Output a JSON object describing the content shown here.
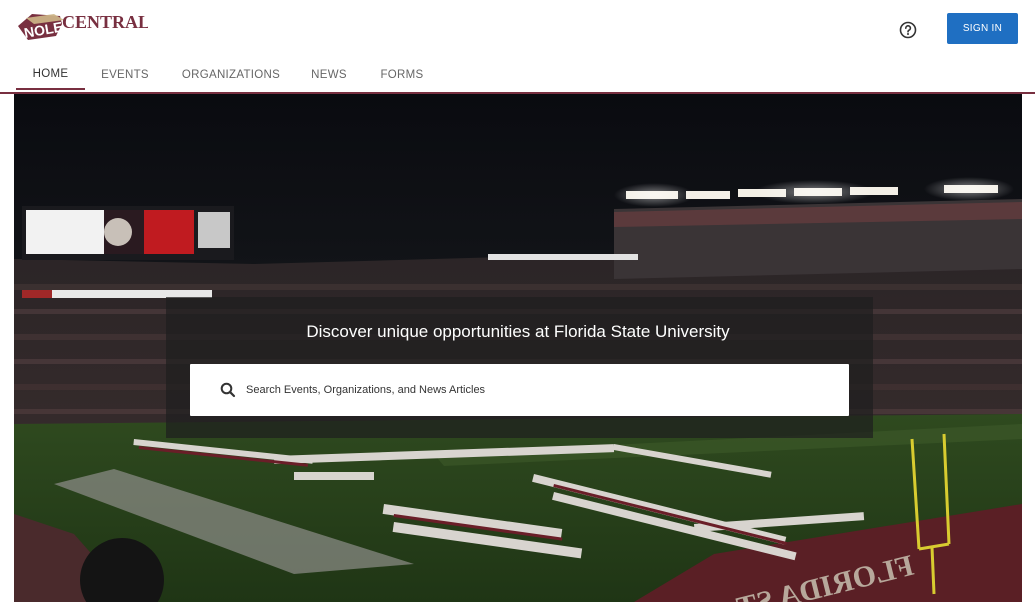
{
  "colors": {
    "brand_garnet": "#782f40",
    "brand_gold": "#ceb888",
    "signin_blue": "#1f6fc2",
    "nav_text": "#666666",
    "active_text": "#333333",
    "hero_text": "#ffffff",
    "panel_overlay": "rgba(30,30,30,0.72)"
  },
  "header": {
    "logo_text": "NOLECENTRAL",
    "help_icon": "question-circle-icon",
    "signin_label": "SIGN IN"
  },
  "nav": {
    "tabs": [
      {
        "label": "HOME",
        "active": true
      },
      {
        "label": "EVENTS",
        "active": false
      },
      {
        "label": "ORGANIZATIONS",
        "active": false
      },
      {
        "label": "NEWS",
        "active": false
      },
      {
        "label": "FORMS",
        "active": false
      }
    ]
  },
  "hero": {
    "title": "Discover unique opportunities at Florida State University",
    "search_placeholder": "Search Events, Organizations, and News Articles",
    "search_icon": "search-icon"
  }
}
